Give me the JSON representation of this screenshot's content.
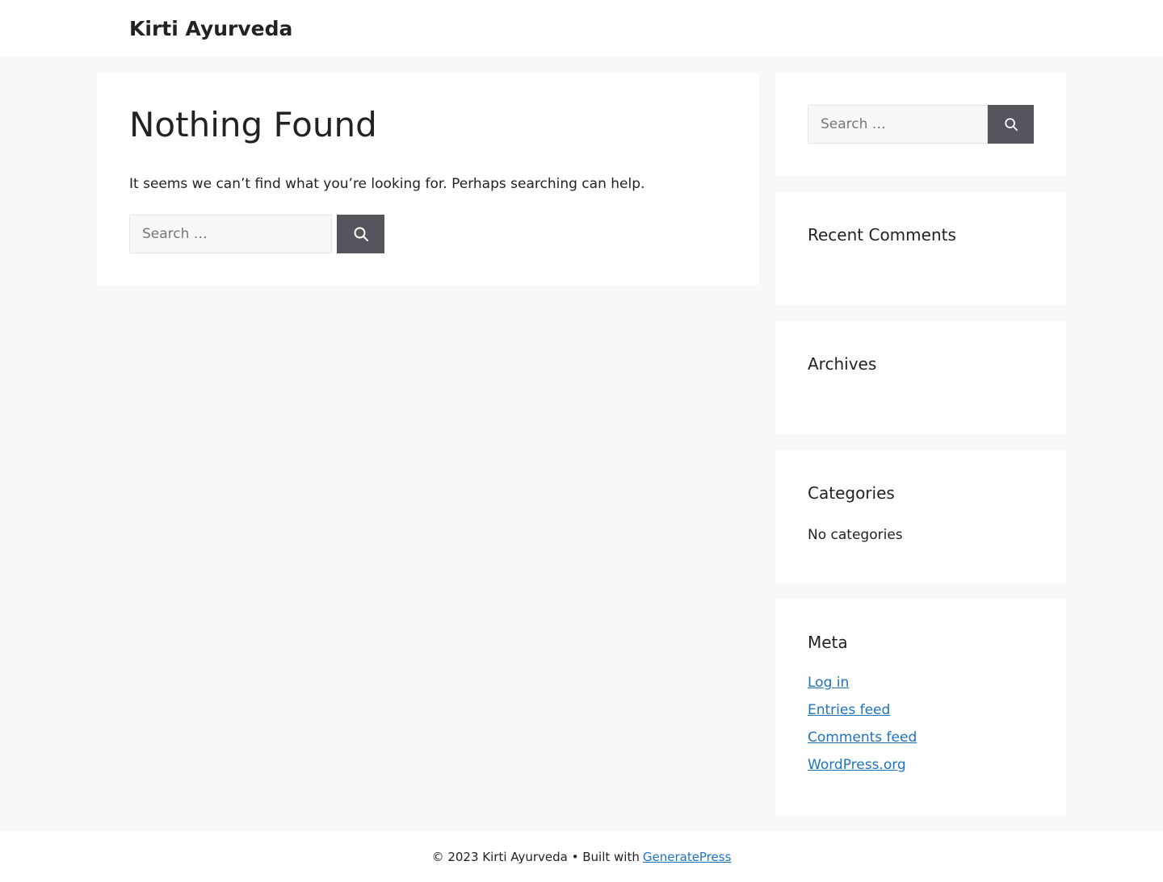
{
  "header": {
    "site_title": "Kirti Ayurveda"
  },
  "main": {
    "title": "Nothing Found",
    "message": "It seems we can’t find what you’re looking for. Perhaps searching can help.",
    "search": {
      "placeholder": "Search …",
      "button_icon": "search-icon"
    }
  },
  "sidebar": {
    "search": {
      "placeholder": "Search …",
      "button_icon": "search-icon"
    },
    "recent_comments": {
      "title": "Recent Comments"
    },
    "archives": {
      "title": "Archives"
    },
    "categories": {
      "title": "Categories",
      "empty_text": "No categories"
    },
    "meta": {
      "title": "Meta",
      "links": [
        "Log in",
        "Entries feed",
        "Comments feed",
        "WordPress.org"
      ]
    }
  },
  "footer": {
    "copyright": "© 2023 Kirti Ayurveda • Built with",
    "link": "GeneratePress"
  },
  "colors": {
    "background": "#f7f8f9",
    "surface": "#ffffff",
    "button": "#55555e",
    "link": "#1e73be",
    "text": "#222222"
  }
}
